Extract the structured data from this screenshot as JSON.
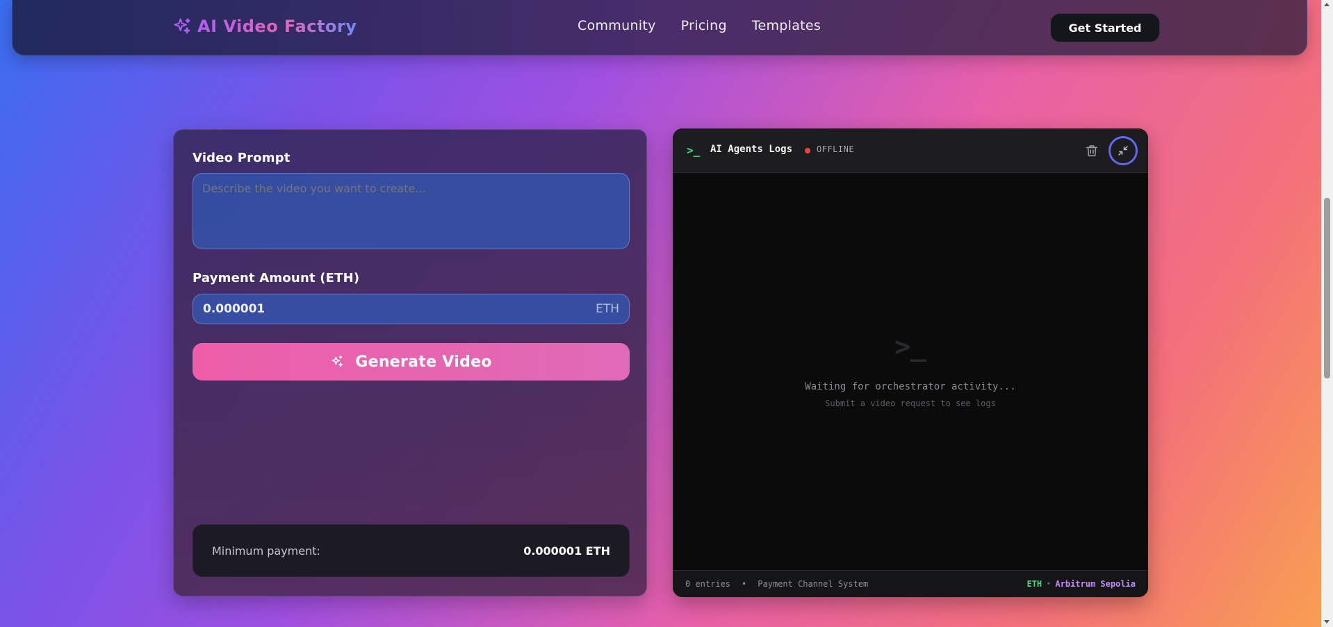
{
  "header": {
    "brand": "AI Video Factory",
    "nav": [
      "Community",
      "Pricing",
      "Templates"
    ],
    "cta": "Get Started"
  },
  "form": {
    "prompt_label": "Video Prompt",
    "prompt_placeholder": "Describe the video you want to create...",
    "amount_label": "Payment Amount (ETH)",
    "amount_value": "0.000001",
    "amount_unit": "ETH",
    "generate_label": "Generate Video",
    "min_label": "Minimum payment:",
    "min_value": "0.000001 ETH"
  },
  "logs": {
    "icon": ">_",
    "title": "AI Agents Logs",
    "status": "OFFLINE",
    "empty_icon": ">_",
    "waiting": "Waiting for orchestrator activity...",
    "hint": "Submit a video request to see logs",
    "entries": "0 entries",
    "system": "Payment Channel System",
    "currency": "ETH",
    "network": "Arbitrum Sepolia"
  },
  "colors": {
    "status_dot": "#ef4444",
    "eth": "#3ddc84",
    "network": "#c08bf5",
    "accent_ring": "#6366f1"
  }
}
